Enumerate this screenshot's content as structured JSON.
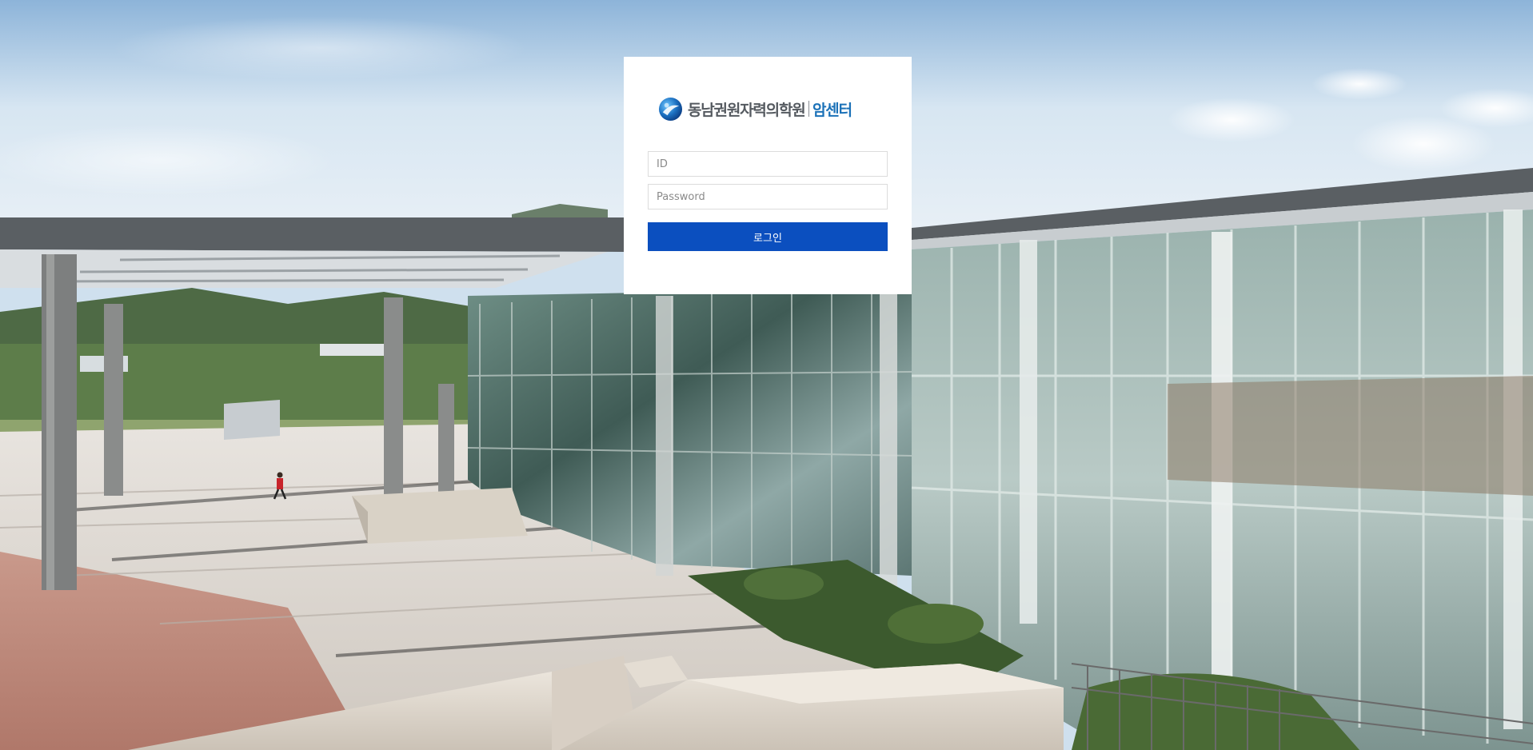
{
  "logo": {
    "name": "동남권원자력의학원",
    "subtitle": "암센터",
    "emblem_icon": "sphere-emblem-icon"
  },
  "form": {
    "id_placeholder": "ID",
    "id_value": "",
    "password_placeholder": "Password",
    "password_value": "",
    "login_label": "로그인"
  },
  "colors": {
    "button": "#0b4fbf",
    "logo_accent": "#1c72b8",
    "logo_text": "#555a60",
    "card": "#ffffff"
  },
  "background": {
    "icon": "building-photo-background"
  }
}
